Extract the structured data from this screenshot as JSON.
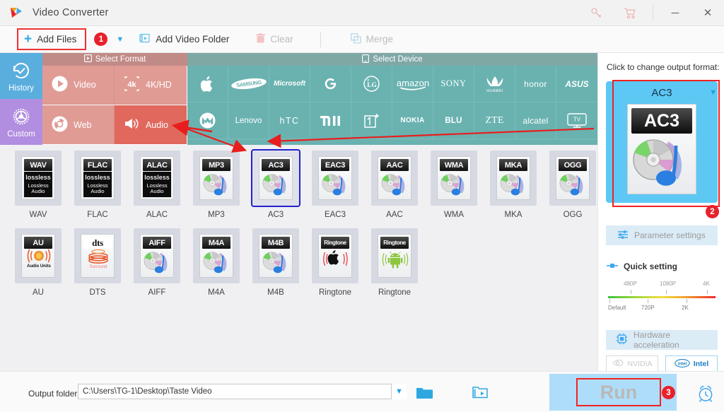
{
  "window": {
    "title": "Video Converter",
    "controls": [
      {
        "name": "key-icon",
        "glyph": "key"
      },
      {
        "name": "cart-icon",
        "glyph": "cart"
      },
      {
        "name": "minimize",
        "glyph": "─"
      },
      {
        "name": "close",
        "glyph": "✕"
      }
    ]
  },
  "toolbar": {
    "add_files": "Add Files",
    "add_files_badge": "1",
    "dropdown_caret": "▼",
    "add_video_folder": "Add Video Folder",
    "clear": "Clear",
    "merge": "Merge"
  },
  "rail": {
    "items": [
      {
        "label": "History",
        "icon": "history-icon"
      },
      {
        "label": "Custom",
        "icon": "gear-icon"
      }
    ]
  },
  "categories": {
    "header": "Select Format",
    "items": [
      {
        "label": "Video",
        "icon": "play-icon",
        "selected": false
      },
      {
        "label": "4K/HD",
        "icon": "4k-icon",
        "selected": false
      },
      {
        "label": "Web",
        "icon": "chrome-icon",
        "selected": false
      },
      {
        "label": "Audio",
        "icon": "speaker-icon",
        "selected": true
      }
    ]
  },
  "devices": {
    "header": "Select Device",
    "items": [
      "Apple",
      "SAMSUNG",
      "Microsoft",
      "G",
      "LG",
      "amazon",
      "SONY",
      "HUAWEI",
      "honor",
      "ASUS",
      "Motorola",
      "Lenovo",
      "hTC",
      "MI",
      "1+",
      "NOKIA",
      "BLU",
      "ZTE",
      "alcatel",
      "TV"
    ]
  },
  "formats": {
    "row1": [
      {
        "label": "WAV",
        "cap": "WAV",
        "art": "lossless",
        "selected": false
      },
      {
        "label": "FLAC",
        "cap": "FLAC",
        "art": "lossless",
        "selected": false
      },
      {
        "label": "ALAC",
        "cap": "ALAC",
        "art": "lossless",
        "selected": false
      },
      {
        "label": "MP3",
        "cap": "MP3",
        "art": "cd",
        "selected": false
      },
      {
        "label": "AC3",
        "cap": "AC3",
        "art": "cd",
        "selected": true
      },
      {
        "label": "EAC3",
        "cap": "EAC3",
        "art": "cd",
        "selected": false
      },
      {
        "label": "AAC",
        "cap": "AAC",
        "art": "cd",
        "selected": false
      },
      {
        "label": "WMA",
        "cap": "WMA",
        "art": "cd",
        "selected": false
      },
      {
        "label": "MKA",
        "cap": "MKA",
        "art": "cd",
        "selected": false
      },
      {
        "label": "OGG",
        "cap": "OGG",
        "art": "cd",
        "selected": false
      }
    ],
    "row2": [
      {
        "label": "AU",
        "cap": "AU",
        "art": "au",
        "selected": false
      },
      {
        "label": "DTS",
        "cap": "dts",
        "art": "dts",
        "selected": false
      },
      {
        "label": "AIFF",
        "cap": "AIFF",
        "art": "cd",
        "selected": false
      },
      {
        "label": "M4A",
        "cap": "M4A",
        "art": "cd",
        "selected": false
      },
      {
        "label": "M4B",
        "cap": "M4B",
        "art": "cd",
        "selected": false
      },
      {
        "label": "Ringtone",
        "cap": "Ringtone",
        "art": "apple",
        "selected": false
      },
      {
        "label": "Ringtone",
        "cap": "Ringtone",
        "art": "android",
        "selected": false
      }
    ],
    "lossless_words": {
      "w1": "lossless",
      "w2": "Lossless",
      "w3": "Audio"
    },
    "au_sub": "Audio Units",
    "dts_sub": "Surround"
  },
  "right_panel": {
    "title": "Click to change output format:",
    "format_name": "AC3",
    "format_cap": "AC3",
    "caret": "▼",
    "badge": "2",
    "parameter_settings": "Parameter settings",
    "quick_setting": "Quick setting",
    "quality_top": [
      "480P",
      "1080P",
      "4K"
    ],
    "quality_bottom": [
      "Default",
      "720P",
      "2K"
    ],
    "hardware_acceleration": "Hardware acceleration",
    "gpus": [
      {
        "label": "NVIDIA",
        "enabled": false
      },
      {
        "label": "Intel",
        "enabled": true
      }
    ]
  },
  "bottom": {
    "output_label": "Output folder:",
    "output_path": "C:\\Users\\TG-1\\Desktop\\Taste Video",
    "output_caret": "▼",
    "folder_icon": "folder-icon",
    "media_icon": "media-folder-icon",
    "run_label": "Run",
    "run_badge": "3",
    "alarm_icon": "alarm-clock-icon"
  },
  "colors": {
    "accent_blue": "#3fa9f0",
    "badge_red": "#e8212b",
    "annotation_red": "#f22222",
    "audio_selected": "#e0685c",
    "device_teal": "#69b2b0",
    "category_salmon": "#e09b95",
    "history_blue": "#5aaede",
    "custom_purple": "#b18ee0"
  }
}
